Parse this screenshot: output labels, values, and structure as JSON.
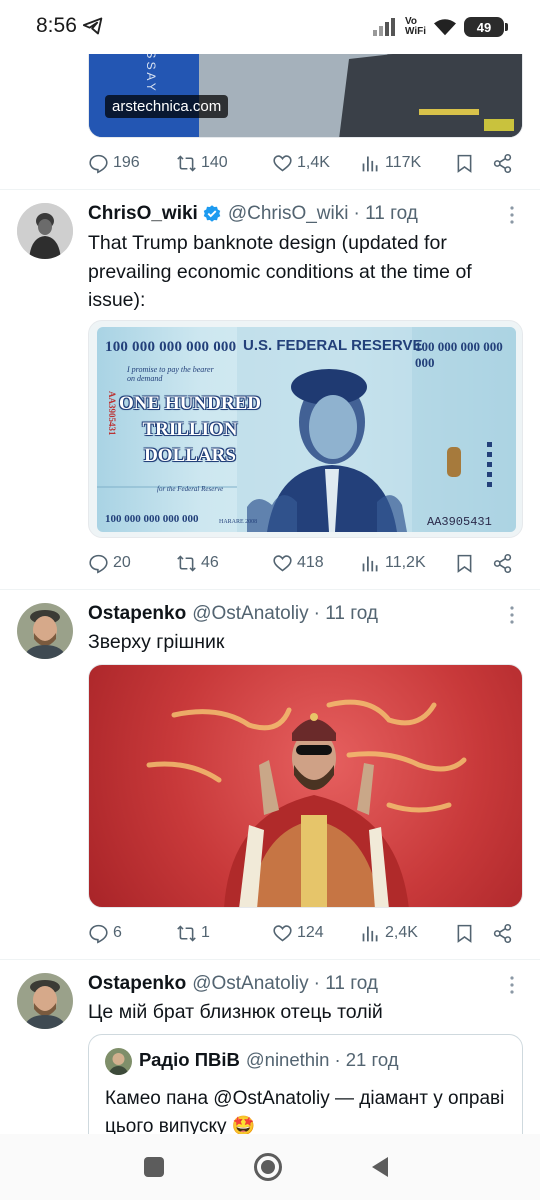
{
  "status_bar": {
    "time": "8:56",
    "network_label_top": "Vo",
    "network_label_bottom": "WiFi",
    "battery": "49"
  },
  "tweets": [
    {
      "link_domain": "arstechnica.com",
      "stats": {
        "replies": "196",
        "retweets": "140",
        "likes": "1,4K",
        "views": "117K"
      }
    },
    {
      "name": "ChrisO_wiki",
      "verified": true,
      "handle": "@ChrisO_wiki",
      "time": "· 11 год",
      "text": "That Trump banknote design (updated for prevailing economic conditions at the time of issue):",
      "banknote": {
        "value_top": "100 000 000 000 000",
        "bank": "U.S. FEDERAL RESERVE",
        "value_top_right": "100 000 000 000 000",
        "promise": "I promise to pay the bearer on demand",
        "words_line1": "ONE HUNDRED",
        "words_line2": "TRILLION",
        "words_line3": "DOLLARS",
        "serial_vertical": "AA3905431",
        "for_text": "for the Federal Reserve",
        "value_bottom": "100 000 000 000 000",
        "city": "HARARE  2008",
        "serial": "AA3905431"
      },
      "stats": {
        "replies": "20",
        "retweets": "46",
        "likes": "418",
        "views": "11,2K"
      }
    },
    {
      "name": "Ostapenko",
      "handle": "@OstAnatoliy",
      "time": "· 11 год",
      "text": "Зверху грішник",
      "stats": {
        "replies": "6",
        "retweets": "1",
        "likes": "124",
        "views": "2,4K"
      }
    },
    {
      "name": "Ostapenko",
      "handle": "@OstAnatoliy",
      "time": "· 11 год",
      "text": "Це мій брат близнюк отець толій",
      "quote": {
        "name": "Радіо ПВіВ",
        "handle": "@ninethin",
        "time": "· 21 год",
        "text": "Камео пана @OstAnatoliy — діамант у оправі цього випуску 🤩"
      }
    }
  ],
  "colors": {
    "text": "#0f1419",
    "secondary": "#536471",
    "verified": "#1d9bf0",
    "divider": "#eff3f4"
  }
}
